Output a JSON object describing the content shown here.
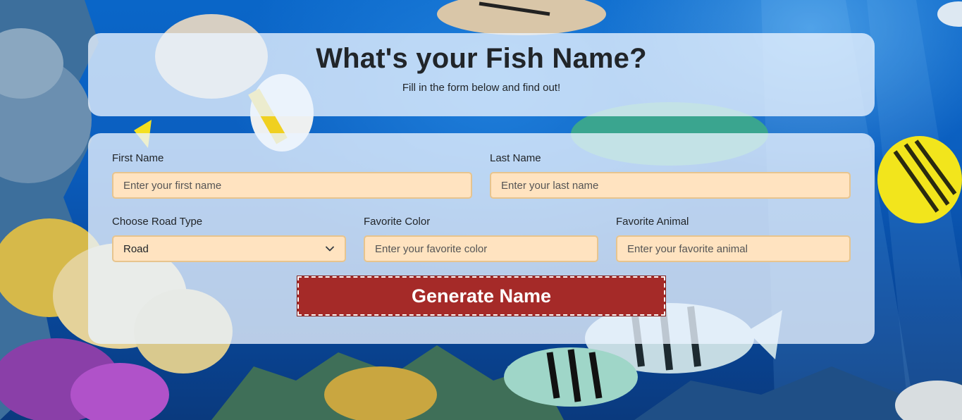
{
  "header": {
    "title": "What's your Fish Name?",
    "subtitle": "Fill in the form below and find out!"
  },
  "form": {
    "first_name": {
      "label": "First Name",
      "placeholder": "Enter your first name"
    },
    "last_name": {
      "label": "Last Name",
      "placeholder": "Enter your last name"
    },
    "road_type": {
      "label": "Choose Road Type",
      "selected": "Road"
    },
    "favorite_color": {
      "label": "Favorite Color",
      "placeholder": "Enter your favorite color"
    },
    "favorite_animal": {
      "label": "Favorite Animal",
      "placeholder": "Enter your favorite animal"
    },
    "submit_label": "Generate Name"
  },
  "colors": {
    "panel_bg": "#ebf3ff",
    "input_bg": "#ffe3c0",
    "input_border": "#e7c48e",
    "button_bg": "#a52a28",
    "text": "#212529"
  },
  "icons": {
    "select_chevron": "chevron-down-icon"
  }
}
